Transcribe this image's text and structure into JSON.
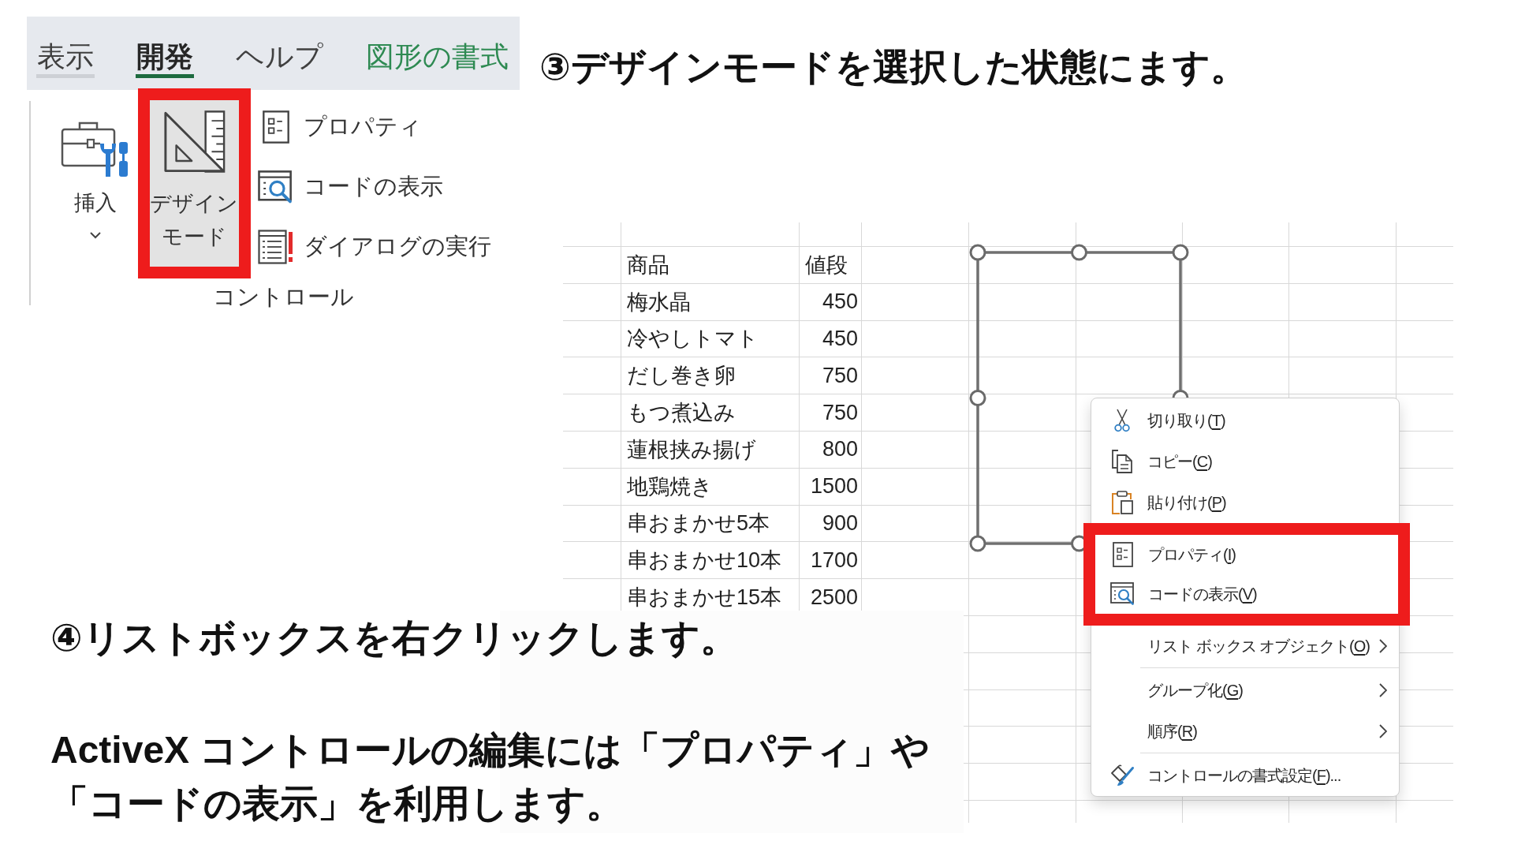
{
  "ribbon": {
    "tabs": [
      {
        "label": "表示",
        "kind": "standard",
        "selected": false,
        "hovered": true
      },
      {
        "label": "開発",
        "kind": "standard",
        "selected": true,
        "hovered": false
      },
      {
        "label": "ヘルプ",
        "kind": "standard",
        "selected": false,
        "hovered": false
      },
      {
        "label": "図形の書式",
        "kind": "contextual",
        "selected": false,
        "hovered": false
      }
    ],
    "group": {
      "label": "コントロール",
      "large_buttons": [
        {
          "kind": "insert",
          "label": "挿入",
          "dropdown": true,
          "pressed": false,
          "highlighted": false
        },
        {
          "kind": "design-mode",
          "label": "デザインモード",
          "dropdown": false,
          "pressed": true,
          "highlighted": true
        }
      ],
      "small_buttons": [
        {
          "kind": "properties",
          "label": "プロパティ"
        },
        {
          "kind": "view-code",
          "label": "コードの表示"
        },
        {
          "kind": "run-dialog",
          "label": "ダイアログの実行"
        }
      ]
    }
  },
  "step_heading": "③デザインモードを選択した状態にます。",
  "sheet": {
    "header": [
      "商品",
      "値段"
    ],
    "rows": [
      [
        "梅水晶",
        "450"
      ],
      [
        "冷やしトマト",
        "450"
      ],
      [
        "だし巻き卵",
        "750"
      ],
      [
        "もつ煮込み",
        "750"
      ],
      [
        "蓮根挟み揚げ",
        "800"
      ],
      [
        "地鶏焼き",
        "1500"
      ],
      [
        "串おまかせ5本",
        "900"
      ],
      [
        "串おまかせ10本",
        "1700"
      ],
      [
        "串おまかせ15本",
        "2500"
      ]
    ]
  },
  "list_box": {
    "selected": true
  },
  "context_menu": {
    "items": [
      {
        "kind": "cut",
        "label": "切り取り(",
        "access_key": "T",
        "label_end": ")",
        "highlighted": false
      },
      {
        "kind": "copy",
        "label": "コピー(",
        "access_key": "C",
        "label_end": ")",
        "highlighted": false
      },
      {
        "kind": "paste",
        "label": "貼り付け(",
        "access_key": "P",
        "label_end": ")",
        "highlighted": false
      },
      {
        "kind": "properties",
        "label": "プロパティ(",
        "access_key": "I",
        "label_end": ")",
        "highlighted": true
      },
      {
        "kind": "view-code",
        "label": "コードの表示(",
        "access_key": "V",
        "label_end": ")",
        "highlighted": true
      },
      {
        "kind": "submenu",
        "label": "リスト ボックス オブジェクト(",
        "access_key": "O",
        "label_end": ")",
        "highlighted": false
      },
      {
        "kind": "separator"
      },
      {
        "kind": "submenu",
        "label": "グループ化(",
        "access_key": "G",
        "label_end": ")",
        "highlighted": false
      },
      {
        "kind": "submenu",
        "label": "順序(",
        "access_key": "R",
        "label_end": ")",
        "highlighted": false
      },
      {
        "kind": "separator"
      },
      {
        "kind": "format",
        "label": "コントロールの書式設定(",
        "access_key": "F",
        "label_end": ")...",
        "highlighted": false
      }
    ]
  },
  "caption": {
    "heading": "④リストボックスを右クリックします。",
    "body": "ActiveX コントロールの編集には「プロパティ」や「コードの表示」を利用します。"
  }
}
